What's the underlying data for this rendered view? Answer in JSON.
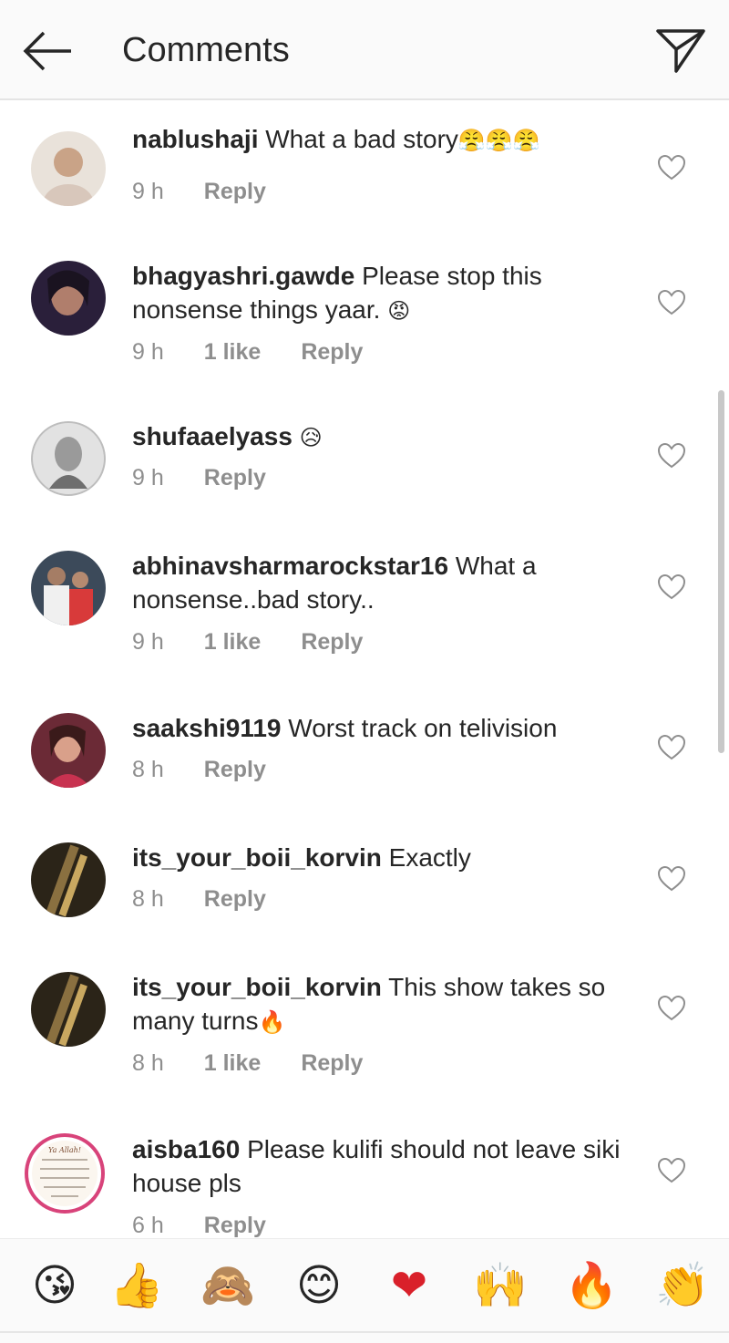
{
  "header": {
    "title": "Comments",
    "back_icon": "arrow-left-icon",
    "send_icon": "direct-send-icon"
  },
  "comments": [
    {
      "username": "nablushaji",
      "text": "What a bad story",
      "emoji": "😤😤😤",
      "time": "9 h",
      "likes": "",
      "reply": "Reply"
    },
    {
      "username": "bhagyashri.gawde",
      "text": "Please stop this nonsense things yaar.",
      "emoji": "😡",
      "time": "9 h",
      "likes": "1 like",
      "reply": "Reply"
    },
    {
      "username": "shufaaelyass",
      "text": "",
      "emoji": "😥",
      "time": "9 h",
      "likes": "",
      "reply": "Reply"
    },
    {
      "username": "abhinavsharmarockstar16",
      "text": "What a nonsense..bad story..",
      "emoji": "",
      "time": "9 h",
      "likes": "1 like",
      "reply": "Reply"
    },
    {
      "username": "saakshi9119",
      "text": "Worst track on telivision",
      "emoji": "",
      "time": "8 h",
      "likes": "",
      "reply": "Reply"
    },
    {
      "username": "its_your_boii_korvin",
      "text": "Exactly",
      "emoji": "",
      "time": "8 h",
      "likes": "",
      "reply": "Reply"
    },
    {
      "username": "its_your_boii_korvin",
      "text": "This show takes so many turns",
      "emoji": "🔥",
      "time": "8 h",
      "likes": "1 like",
      "reply": "Reply"
    },
    {
      "username": "aisba160",
      "text": "Please kulifi should not leave siki house pls",
      "emoji": "",
      "time": "6 h",
      "likes": "",
      "reply": "Reply"
    }
  ],
  "avatar_badge_text": "Ya Allah! protect us and our children from jealousy, magic and evil eye. Ameen",
  "quick_emojis": [
    "😘",
    "👍",
    "🙈",
    "😊",
    "❤",
    "🙌",
    "🔥",
    "👏"
  ]
}
